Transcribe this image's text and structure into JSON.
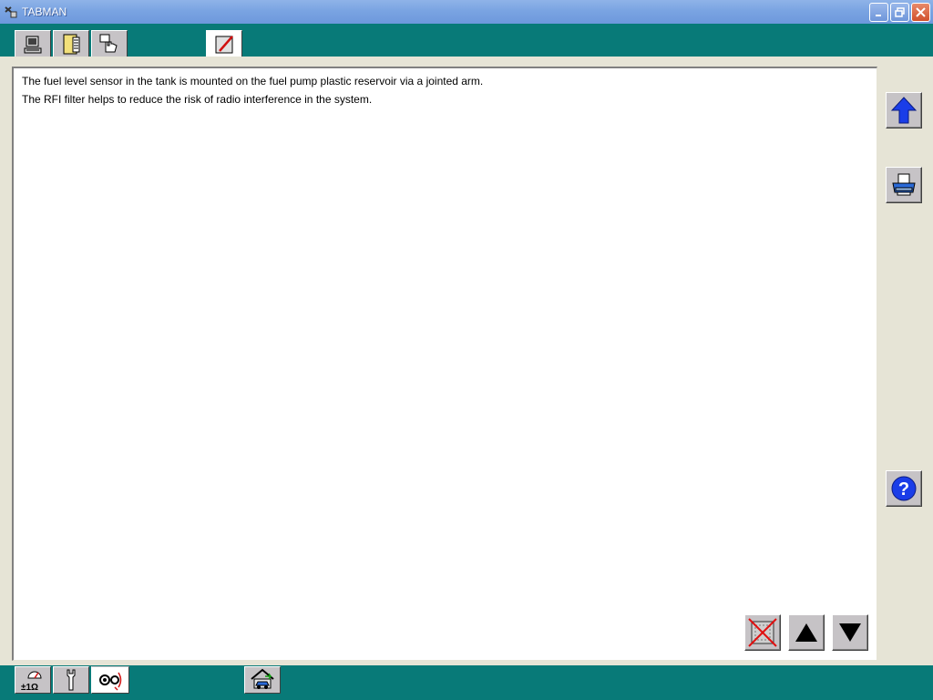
{
  "window": {
    "title": "TABMAN"
  },
  "top_toolbar": {
    "tabs": [
      {
        "icon": "computer-icon"
      },
      {
        "icon": "document-icon"
      },
      {
        "icon": "hand-pointer-icon"
      },
      {
        "icon": "pencil-edit-icon"
      }
    ]
  },
  "document": {
    "lines": [
      "The fuel level sensor in the tank is mounted on the fuel pump plastic reservoir via a jointed arm.",
      "The RFI filter helps to reduce the risk of radio interference in the system."
    ]
  },
  "side_buttons": [
    {
      "icon": "arrow-up-icon"
    },
    {
      "icon": "printer-icon"
    },
    {
      "icon": "help-icon"
    }
  ],
  "nav_buttons": [
    {
      "icon": "cancel-image-icon"
    },
    {
      "icon": "triangle-up-icon"
    },
    {
      "icon": "triangle-down-icon"
    }
  ],
  "bottom_toolbar": {
    "tabs": [
      {
        "icon": "meter-resistance-icon",
        "label": "±1Ω"
      },
      {
        "icon": "wrench-icon"
      },
      {
        "icon": "sensor-signal-icon"
      },
      {
        "icon": "car-home-icon"
      }
    ]
  },
  "colors": {
    "background": "#087a78",
    "titlebar": "#7aa4e2",
    "panel": "#e6e4d6",
    "button_face": "#c6c3c6",
    "accent_blue": "#1a3de8"
  }
}
